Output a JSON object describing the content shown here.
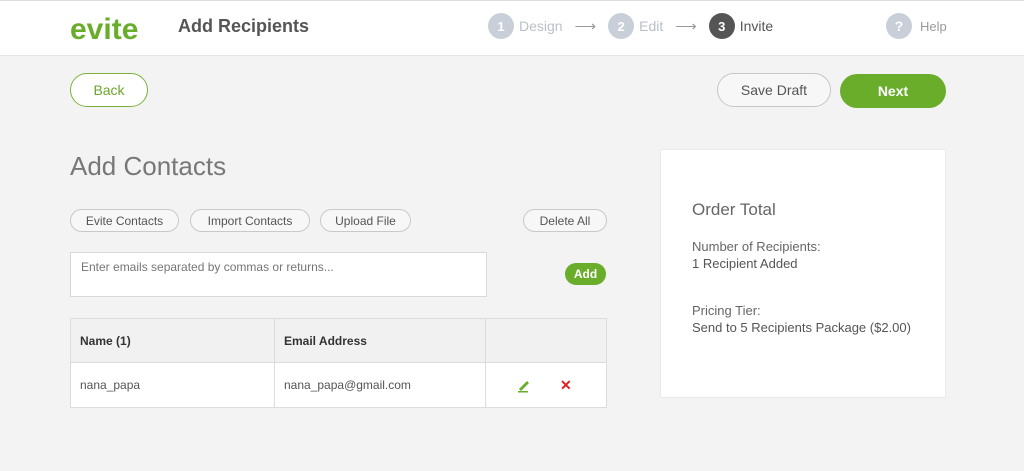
{
  "header": {
    "logo_text": "evite",
    "title": "Add Recipients",
    "steps": [
      {
        "num": "1",
        "label": "Design"
      },
      {
        "num": "2",
        "label": "Edit"
      },
      {
        "num": "3",
        "label": "Invite"
      }
    ],
    "arrow": "⟶",
    "help_icon": "?",
    "help_label": "Help"
  },
  "actions": {
    "back": "Back",
    "save_draft": "Save Draft",
    "next": "Next"
  },
  "contacts": {
    "title": "Add Contacts",
    "buttons": {
      "evite_contacts": "Evite Contacts",
      "import_contacts": "Import Contacts",
      "upload_file": "Upload File",
      "delete_all": "Delete All"
    },
    "input_placeholder": "Enter emails separated by commas or returns...",
    "add": "Add",
    "table": {
      "headers": [
        "Name (1)",
        "Email Address",
        ""
      ],
      "rows": [
        {
          "name": "nana_papa",
          "email": "nana_papa@gmail.com"
        }
      ]
    }
  },
  "order": {
    "title": "Order Total",
    "recipients_label": "Number of Recipients:",
    "recipients_value": "1 Recipient Added",
    "tier_label": "Pricing Tier:",
    "tier_value": "Send to 5 Recipients Package ($2.00)"
  },
  "colors": {
    "brand_green": "#6aad2b",
    "delete_red": "#e02020",
    "step_inactive": "#c9cfd8",
    "step_active": "#555555"
  },
  "icons": {
    "edit": "pencil-icon",
    "delete": "x-icon",
    "help": "question-icon"
  }
}
